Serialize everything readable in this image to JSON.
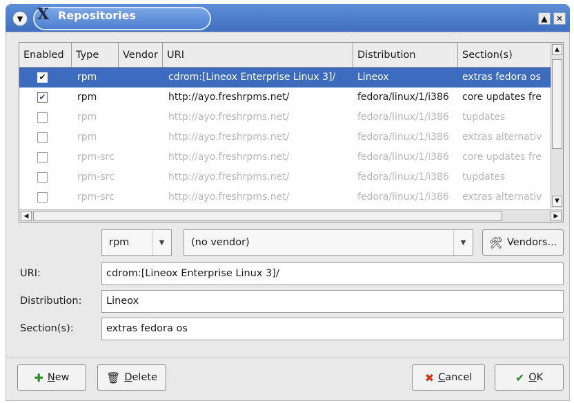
{
  "window": {
    "title": "Repositories",
    "title_icon": "x-logo-icon",
    "controls": [
      "maximize-icon",
      "close-icon"
    ]
  },
  "table": {
    "columns": [
      "Enabled",
      "Type",
      "Vendor",
      "URI",
      "Distribution",
      "Section(s)"
    ],
    "rows": [
      {
        "enabled": true,
        "type": "rpm",
        "vendor": "",
        "uri": "cdrom:[Lineox Enterprise Linux 3]/",
        "distribution": "Lineox",
        "sections": "extras fedora os",
        "state": "selected"
      },
      {
        "enabled": true,
        "type": "rpm",
        "vendor": "",
        "uri": "http://ayo.freshrpms.net/",
        "distribution": "fedora/linux/1/i386",
        "sections": "core updates fre",
        "state": "normal"
      },
      {
        "enabled": false,
        "type": "rpm",
        "vendor": "",
        "uri": "http://ayo.freshrpms.net/",
        "distribution": "fedora/linux/1/i386",
        "sections": "tupdates",
        "state": "disabled"
      },
      {
        "enabled": false,
        "type": "rpm",
        "vendor": "",
        "uri": "http://ayo.freshrpms.net/",
        "distribution": "fedora/linux/1/i386",
        "sections": "extras alternativ",
        "state": "disabled"
      },
      {
        "enabled": false,
        "type": "rpm-src",
        "vendor": "",
        "uri": "http://ayo.freshrpms.net/",
        "distribution": "fedora/linux/1/i386",
        "sections": "core updates fre",
        "state": "disabled"
      },
      {
        "enabled": false,
        "type": "rpm-src",
        "vendor": "",
        "uri": "http://ayo.freshrpms.net/",
        "distribution": "fedora/linux/1/i386",
        "sections": "tupdates",
        "state": "disabled"
      },
      {
        "enabled": false,
        "type": "rpm-src",
        "vendor": "",
        "uri": "http://ayo.freshrpms.net/",
        "distribution": "fedora/linux/1/i386",
        "sections": "extras alternativ",
        "state": "disabled"
      }
    ]
  },
  "editor": {
    "type_value": "rpm",
    "vendor_value": "(no vendor)",
    "vendors_button": "Vendors...",
    "uri_label": "URI:",
    "uri_value": "cdrom:[Lineox Enterprise Linux 3]/",
    "distribution_label": "Distribution:",
    "distribution_value": "Lineox",
    "sections_label": "Section(s):",
    "sections_value": "extras fedora os"
  },
  "buttons": {
    "new_mnemonic": "N",
    "new_rest": "ew",
    "delete_mnemonic": "D",
    "delete_rest": "elete",
    "cancel_mnemonic": "C",
    "cancel_rest": "ancel",
    "ok_mnemonic": "O",
    "ok_rest": "K"
  },
  "colors": {
    "titlebar": "#4f80cf",
    "selection": "#3d6bbd"
  }
}
